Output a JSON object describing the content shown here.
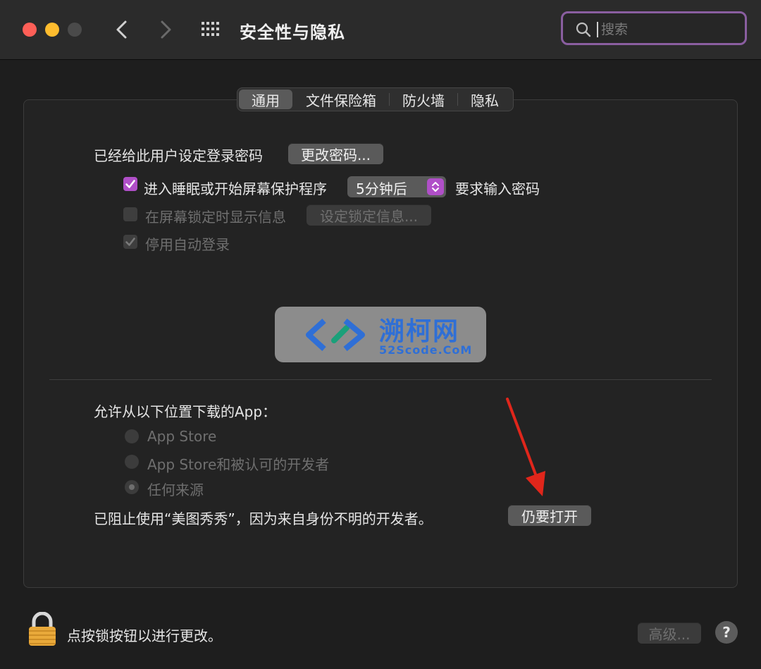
{
  "window": {
    "title": "安全性与隐私",
    "search_placeholder": "搜索"
  },
  "icons": {
    "back": "chevron-left-icon",
    "forward": "chevron-right-icon",
    "grid": "grid-icon",
    "search": "search-icon",
    "lock": "lock-icon",
    "help": "question-mark-icon"
  },
  "tabs": [
    {
      "label": "通用",
      "active": true
    },
    {
      "label": "文件保险箱",
      "active": false
    },
    {
      "label": "防火墙",
      "active": false
    },
    {
      "label": "隐私",
      "active": false
    }
  ],
  "general": {
    "password_label": "已经给此用户设定登录密码",
    "change_password_button": "更改密码...",
    "require_password": {
      "label": "进入睡眠或开始屏幕保护程序",
      "checked": true,
      "delay_value": "5分钟后",
      "suffix": "要求输入密码"
    },
    "show_message": {
      "label": "在屏幕锁定时显示信息",
      "checked": false,
      "button": "设定锁定信息..."
    },
    "disable_autologin": {
      "label": "停用自动登录",
      "checked": true
    }
  },
  "watermark": {
    "title": "溯柯网",
    "subtitle": "52Scode.CoM"
  },
  "downloads": {
    "heading": "允许从以下位置下载的App：",
    "options": [
      {
        "label": "App Store",
        "selected": false
      },
      {
        "label": "App Store和被认可的开发者",
        "selected": false
      },
      {
        "label": "任何来源",
        "selected": true
      }
    ],
    "blocked_message": "已阻止使用“美图秀秀”，因为来自身份不明的开发者。",
    "open_anyway_button": "仍要打开"
  },
  "footer": {
    "lock_text": "点按锁按钮以进行更改。",
    "advanced_button": "高级...",
    "help_label": "?"
  },
  "colors": {
    "accent": "#b04fc8",
    "search_border": "#8a5ea0",
    "arrow": "#e0261b"
  }
}
